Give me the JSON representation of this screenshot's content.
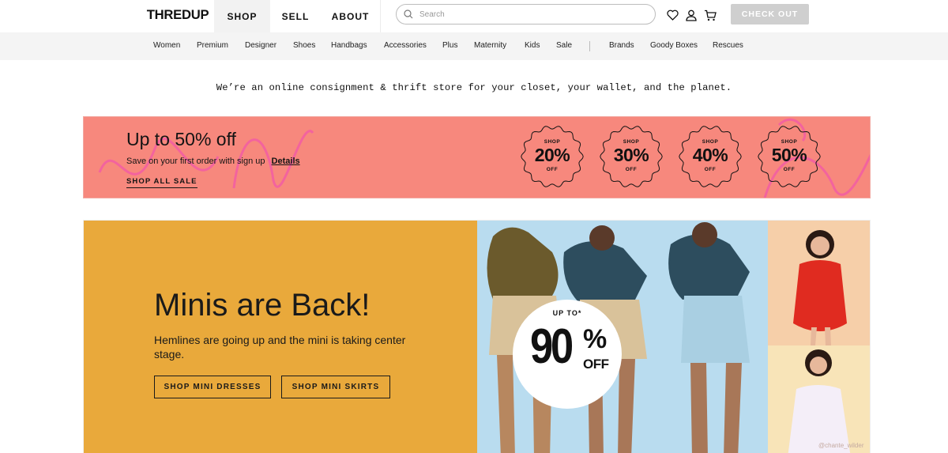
{
  "header": {
    "logo": "THREDUP",
    "nav": {
      "shop": "SHOP",
      "sell": "SELL",
      "about": "ABOUT"
    },
    "search_placeholder": "Search",
    "checkout_label": "CHECK OUT",
    "icons": [
      "heart-icon",
      "user-icon",
      "cart-icon",
      "search-icon"
    ]
  },
  "categories": {
    "women": "Women",
    "premium": "Premium",
    "designer": "Designer",
    "shoes": "Shoes",
    "handbags": "Handbags",
    "accessories": "Accessories",
    "plus": "Plus",
    "maternity": "Maternity",
    "kids": "Kids",
    "sale": "Sale",
    "brands": "Brands",
    "goody_boxes": "Goody Boxes",
    "rescues": "Rescues"
  },
  "tagline": "We’re an online consignment & thrift store for your closet, your wallet, and the planet.",
  "sale_banner": {
    "title": "Up to 50% off",
    "subtitle": "Save on your first order with sign up",
    "details_link": "Details",
    "shop_all": "SHOP ALL SALE",
    "badges": [
      {
        "top": "SHOP",
        "percent": "20%",
        "bottom": "OFF"
      },
      {
        "top": "SHOP",
        "percent": "30%",
        "bottom": "OFF"
      },
      {
        "top": "SHOP",
        "percent": "40%",
        "bottom": "OFF"
      },
      {
        "top": "SHOP",
        "percent": "50%",
        "bottom": "OFF"
      }
    ],
    "colors": {
      "background": "#f7887d",
      "accent": "#f15aa6"
    }
  },
  "hero": {
    "title": "Minis are Back!",
    "description": "Hemlines are going up and the mini is taking center stage.",
    "button_dresses": "SHOP MINI DRESSES",
    "button_skirts": "SHOP MINI SKIRTS",
    "promo": {
      "up_to": "UP TO*",
      "number": "90",
      "percent_sign": "%",
      "off": "OFF"
    },
    "photo_credit": "@chante_wilder",
    "colors": {
      "panel": "#e9a93b",
      "photo_bg": "#b9dcef"
    }
  }
}
